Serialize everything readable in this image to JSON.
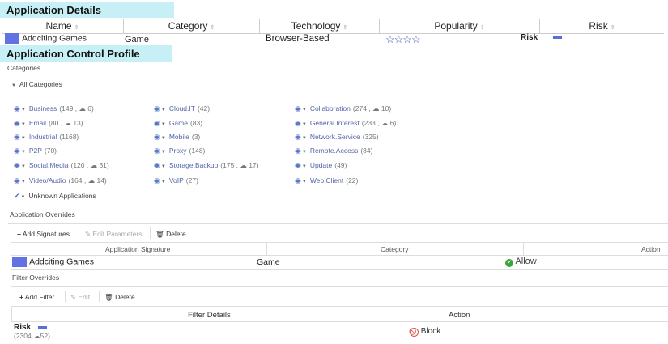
{
  "app_details": {
    "banner": "Application Details",
    "columns": [
      "Name",
      "Category",
      "Technology",
      "Popularity",
      "Risk"
    ],
    "row": {
      "name": "Addciting Games",
      "category": "Game",
      "technology": "Browser-Based",
      "popularity_stars": "☆☆☆☆",
      "popularity_rating": 0,
      "risk": "Risk"
    }
  },
  "profile": {
    "banner": "Application Control Profile",
    "categories_label": "Categories",
    "all_categories": "All Categories",
    "unknown_apps": "Unknown Applications"
  },
  "categories": {
    "col1": [
      {
        "name": "Business",
        "count": "(149",
        "cloud": "6)"
      },
      {
        "name": "Email",
        "count": "(80",
        "cloud": "13)"
      },
      {
        "name": "Industrial",
        "count": "(1168)",
        "cloud": ""
      },
      {
        "name": "P2P",
        "count": "(70)",
        "cloud": ""
      },
      {
        "name": "Social.Media",
        "count": "(120",
        "cloud": "31)"
      },
      {
        "name": "Video/Audio",
        "count": "(164",
        "cloud": "14)"
      }
    ],
    "col2": [
      {
        "name": "Cloud.IT",
        "count": "(42)",
        "cloud": ""
      },
      {
        "name": "Game",
        "count": "(83)",
        "cloud": ""
      },
      {
        "name": "Mobile",
        "count": "(3)",
        "cloud": ""
      },
      {
        "name": "Proxy",
        "count": "(148)",
        "cloud": ""
      },
      {
        "name": "Storage.Backup",
        "count": "(175",
        "cloud": "17)"
      },
      {
        "name": "VoIP",
        "count": "(27)",
        "cloud": ""
      }
    ],
    "col3": [
      {
        "name": "Collaboration",
        "count": "(274",
        "cloud": "10)"
      },
      {
        "name": "General.Interest",
        "count": "(233",
        "cloud": "6)"
      },
      {
        "name": "Network.Service",
        "count": "(325)",
        "cloud": ""
      },
      {
        "name": "Remote.Access",
        "count": "(84)",
        "cloud": ""
      },
      {
        "name": "Update",
        "count": "(49)",
        "cloud": ""
      },
      {
        "name": "Web.Client",
        "count": "(22)",
        "cloud": ""
      }
    ]
  },
  "overrides": {
    "label": "Application Overrides",
    "add_signatures": "Add Signatures",
    "edit_parameters": "Edit Parameters",
    "delete": "Delete",
    "col_signature": "Application Signature",
    "col_category": "Category",
    "col_action": "Action",
    "row": {
      "signature": "Addciting Games",
      "category": "Game",
      "action": "Allow"
    }
  },
  "filters": {
    "label": "Filter Overrides",
    "add_filter": "Add Filter",
    "edit": "Edit",
    "delete": "Delete",
    "col_details": "Filter Details",
    "col_action": "Action",
    "row": {
      "name": "Risk",
      "count": "(2304",
      "cloud": "52)",
      "action": "Block"
    }
  },
  "colors": {
    "banner_bg": "#c7f0f6",
    "accent": "#6272e3",
    "link": "#5566aa",
    "allow": "#3aa53a",
    "block": "#d9534f"
  }
}
